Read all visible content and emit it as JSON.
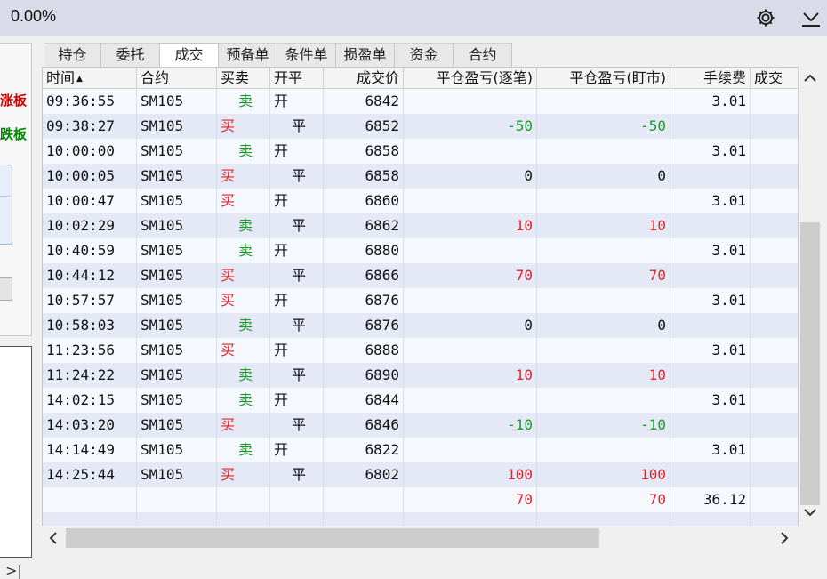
{
  "header": {
    "percent": "0.00%"
  },
  "icons": {
    "settings": "gear-icon",
    "download": "chevron-down-bar-icon"
  },
  "left_panel": {
    "label_limit_up": "涨板",
    "label_limit_down": "跌板",
    "collapse_glyph": ">|"
  },
  "tabs": [
    {
      "label": "持仓",
      "active": false
    },
    {
      "label": "委托",
      "active": false
    },
    {
      "label": "成交",
      "active": true
    },
    {
      "label": "预备单",
      "active": false
    },
    {
      "label": "条件单",
      "active": false
    },
    {
      "label": "损盈单",
      "active": false
    },
    {
      "label": "资金",
      "active": false
    },
    {
      "label": "合约",
      "active": false
    }
  ],
  "table": {
    "columns": [
      "时间",
      "合约",
      "买卖",
      "开平",
      "成交价",
      "平仓盈亏(逐笔)",
      "平仓盈亏(盯市)",
      "手续费",
      "成交"
    ],
    "sort_indicator": "▲",
    "rows": [
      {
        "time": "09:36:55",
        "contract": "SM105",
        "side": "卖",
        "open_close": "开",
        "price": "6842",
        "pnl_trade": "",
        "pnl_mark": "",
        "fee": "3.01"
      },
      {
        "time": "09:38:27",
        "contract": "SM105",
        "side": "买",
        "open_close": "平",
        "price": "6852",
        "pnl_trade": "-50",
        "pnl_mark": "-50",
        "fee": ""
      },
      {
        "time": "10:00:00",
        "contract": "SM105",
        "side": "卖",
        "open_close": "开",
        "price": "6858",
        "pnl_trade": "",
        "pnl_mark": "",
        "fee": "3.01"
      },
      {
        "time": "10:00:05",
        "contract": "SM105",
        "side": "买",
        "open_close": "平",
        "price": "6858",
        "pnl_trade": "0",
        "pnl_mark": "0",
        "fee": ""
      },
      {
        "time": "10:00:47",
        "contract": "SM105",
        "side": "买",
        "open_close": "开",
        "price": "6860",
        "pnl_trade": "",
        "pnl_mark": "",
        "fee": "3.01"
      },
      {
        "time": "10:02:29",
        "contract": "SM105",
        "side": "卖",
        "open_close": "平",
        "price": "6862",
        "pnl_trade": "10",
        "pnl_mark": "10",
        "fee": ""
      },
      {
        "time": "10:40:59",
        "contract": "SM105",
        "side": "卖",
        "open_close": "开",
        "price": "6880",
        "pnl_trade": "",
        "pnl_mark": "",
        "fee": "3.01"
      },
      {
        "time": "10:44:12",
        "contract": "SM105",
        "side": "买",
        "open_close": "平",
        "price": "6866",
        "pnl_trade": "70",
        "pnl_mark": "70",
        "fee": ""
      },
      {
        "time": "10:57:57",
        "contract": "SM105",
        "side": "买",
        "open_close": "开",
        "price": "6876",
        "pnl_trade": "",
        "pnl_mark": "",
        "fee": "3.01"
      },
      {
        "time": "10:58:03",
        "contract": "SM105",
        "side": "卖",
        "open_close": "平",
        "price": "6876",
        "pnl_trade": "0",
        "pnl_mark": "0",
        "fee": ""
      },
      {
        "time": "11:23:56",
        "contract": "SM105",
        "side": "买",
        "open_close": "开",
        "price": "6888",
        "pnl_trade": "",
        "pnl_mark": "",
        "fee": "3.01"
      },
      {
        "time": "11:24:22",
        "contract": "SM105",
        "side": "卖",
        "open_close": "平",
        "price": "6890",
        "pnl_trade": "10",
        "pnl_mark": "10",
        "fee": ""
      },
      {
        "time": "14:02:15",
        "contract": "SM105",
        "side": "卖",
        "open_close": "开",
        "price": "6844",
        "pnl_trade": "",
        "pnl_mark": "",
        "fee": "3.01"
      },
      {
        "time": "14:03:20",
        "contract": "SM105",
        "side": "买",
        "open_close": "平",
        "price": "6846",
        "pnl_trade": "-10",
        "pnl_mark": "-10",
        "fee": ""
      },
      {
        "time": "14:14:49",
        "contract": "SM105",
        "side": "卖",
        "open_close": "开",
        "price": "6822",
        "pnl_trade": "",
        "pnl_mark": "",
        "fee": "3.01"
      },
      {
        "time": "14:25:44",
        "contract": "SM105",
        "side": "买",
        "open_close": "平",
        "price": "6802",
        "pnl_trade": "100",
        "pnl_mark": "100",
        "fee": ""
      }
    ],
    "totals": {
      "pnl_trade": "70",
      "pnl_mark": "70",
      "fee": "36.12"
    }
  },
  "colors": {
    "buy": "#e0262b",
    "sell": "#1a9a2a",
    "profit": "#e0262b",
    "loss": "#1a9a2a",
    "row_alt": "#e4e9f5"
  }
}
